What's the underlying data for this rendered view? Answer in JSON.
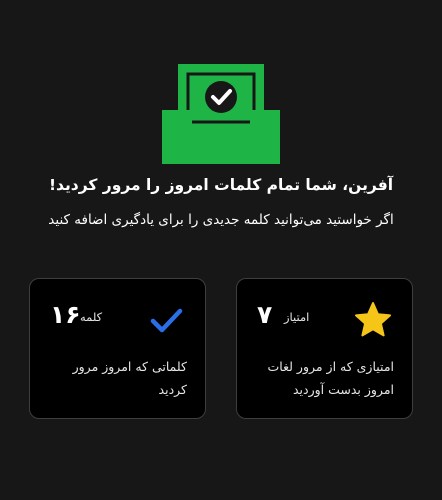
{
  "summary": {
    "title": "آفرین، شما تمام کلمات امروز را مرور کردید!",
    "subtitle": "اگر خواستید می‌توانید کلمه جدیدی را برای یادگیری اضافه کنید"
  },
  "cards": {
    "score": {
      "label": "امتیاز",
      "value": "۷",
      "description": "امتیازی که از مرور لغات امروز بدست آوردید",
      "icon": "star-icon",
      "icon_color": "#f5c518"
    },
    "words": {
      "label": "کلمه",
      "value": "۱۶",
      "description": "کلماتی که امروز مرور کردید",
      "icon": "checkmark-icon",
      "icon_color": "#2a6fe8"
    }
  },
  "hero": {
    "icon": "inbox-check-icon",
    "color": "#1eb446"
  }
}
